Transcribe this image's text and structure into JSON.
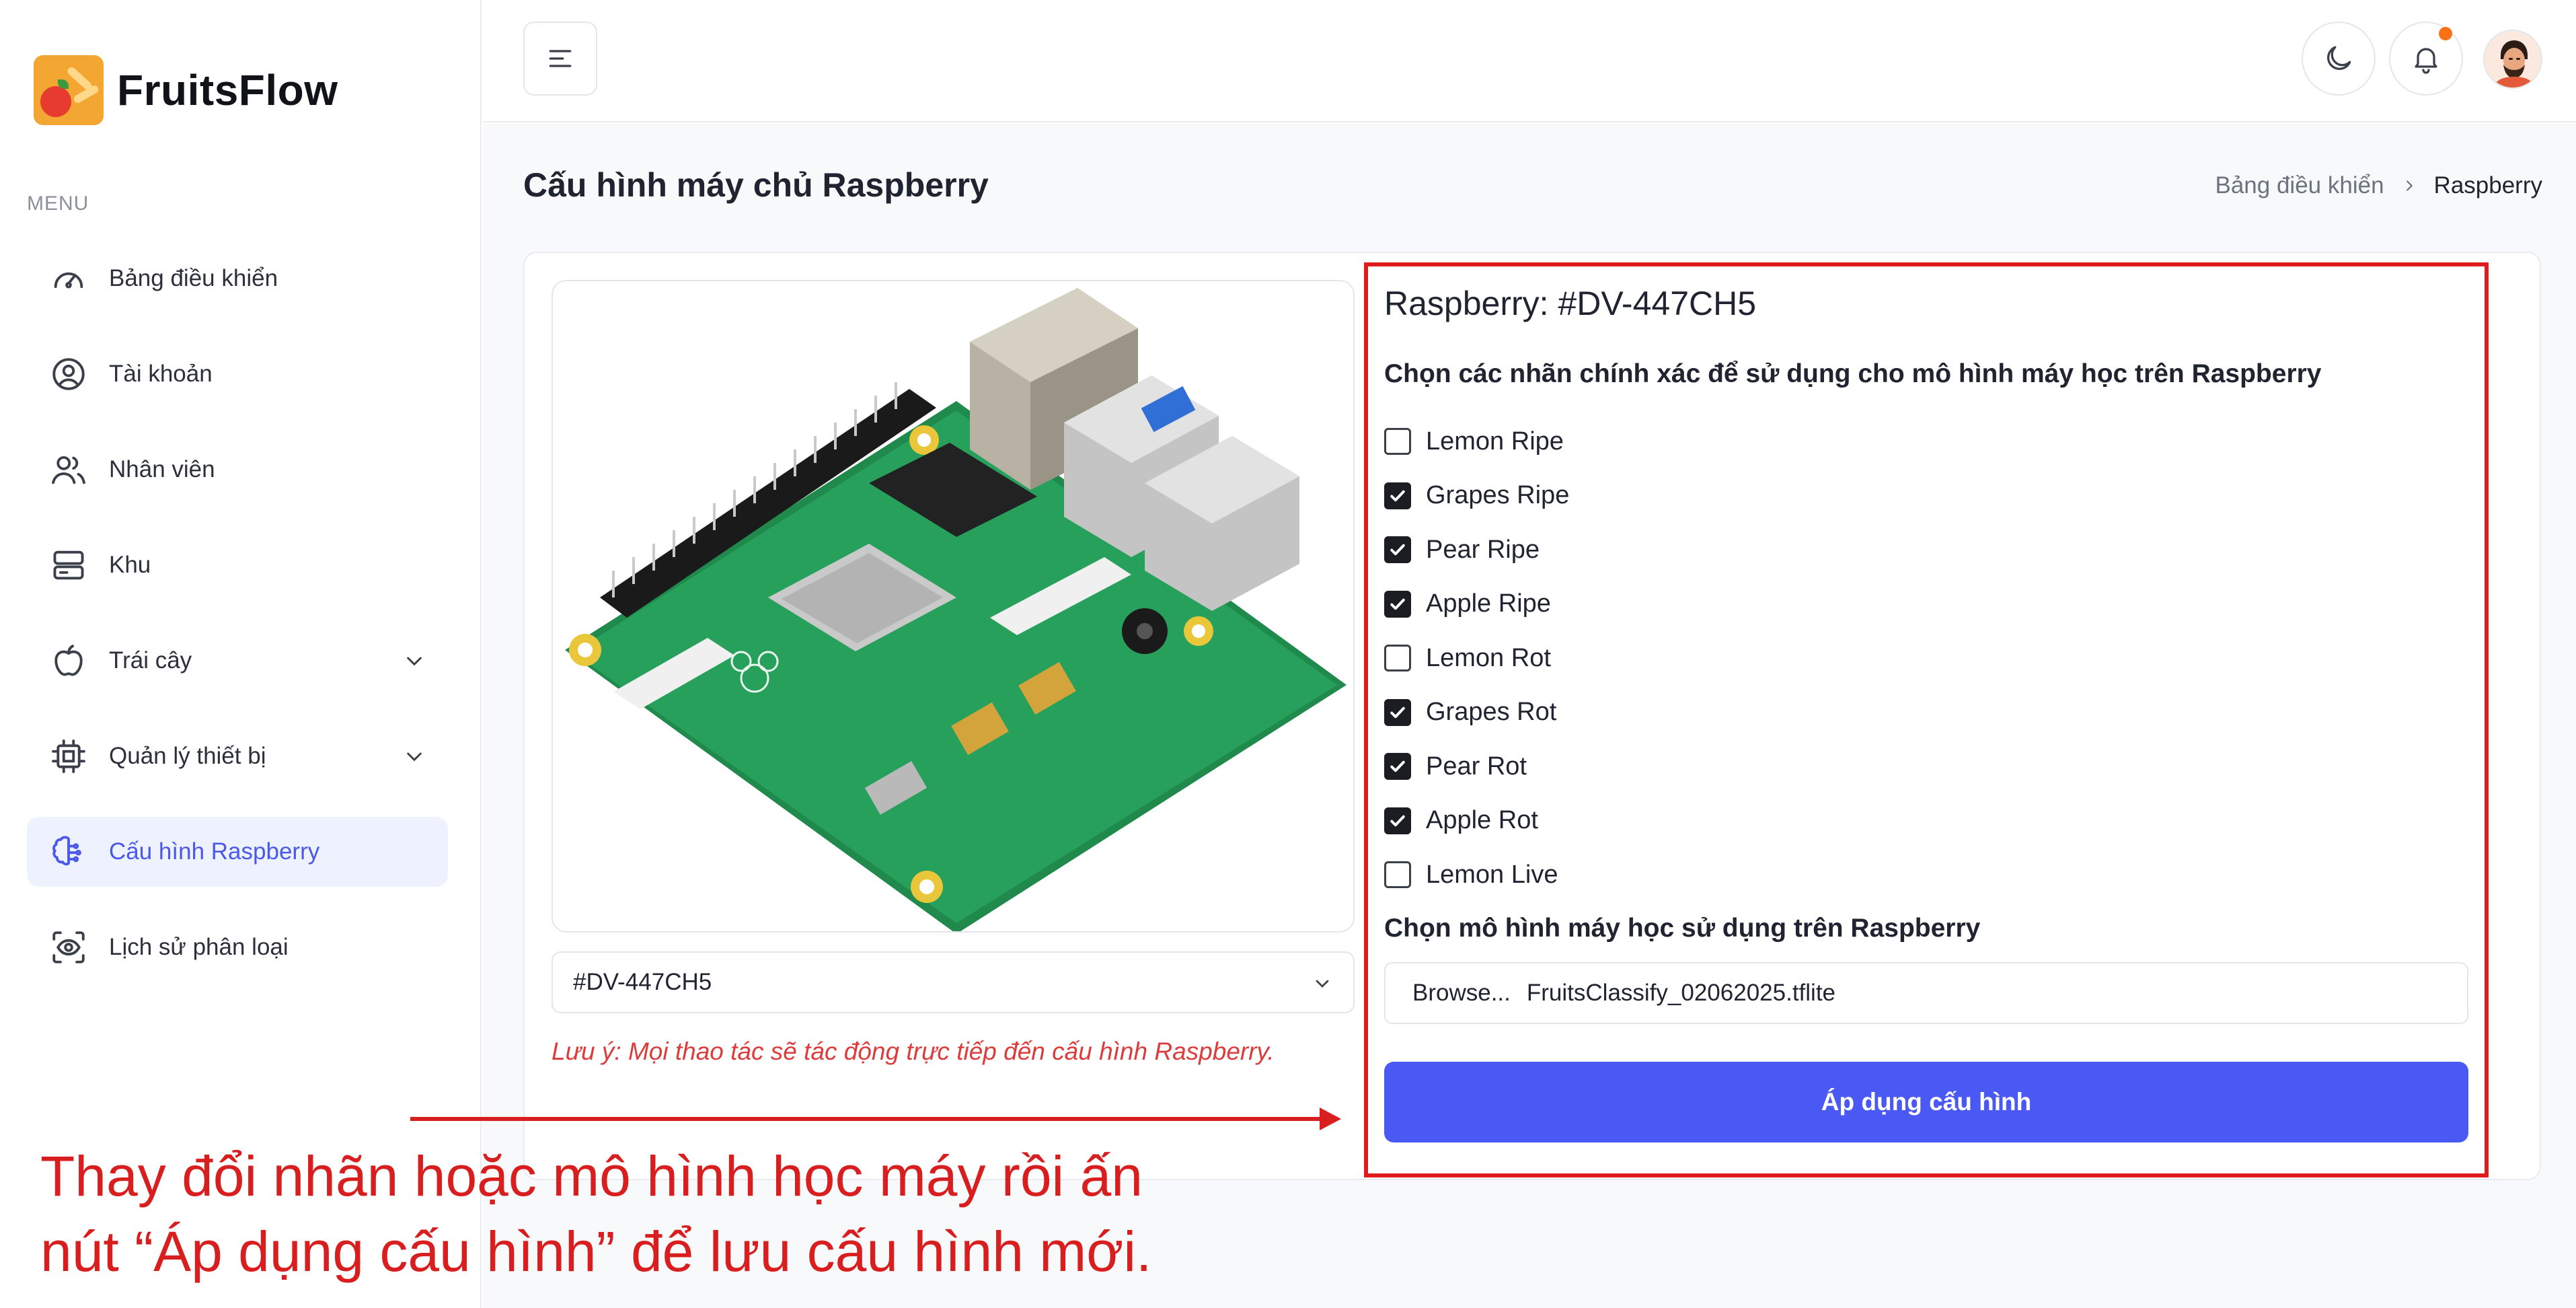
{
  "app": {
    "name": "FruitsFlow"
  },
  "sidebar": {
    "menu_label": "MENU",
    "items": [
      {
        "label": "Bảng điều khiển",
        "icon": "dashboard-gauge-icon"
      },
      {
        "label": "Tài khoản",
        "icon": "user-circle-icon"
      },
      {
        "label": "Nhân viên",
        "icon": "users-icon"
      },
      {
        "label": "Khu",
        "icon": "server-icon"
      },
      {
        "label": "Trái cây",
        "icon": "apple-icon",
        "expandable": true
      },
      {
        "label": "Quản lý thiết bị",
        "icon": "cpu-chip-icon",
        "expandable": true
      },
      {
        "label": "Cấu hình Raspberry",
        "icon": "brain-icon",
        "active": true
      },
      {
        "label": "Lịch sử phân loại",
        "icon": "eye-scan-icon"
      }
    ]
  },
  "header": {
    "menu_icon": "hamburger-icon",
    "theme_icon": "moon-icon",
    "notification_icon": "bell-icon",
    "notification_badge_color": "#f97316"
  },
  "page": {
    "title": "Cấu hình máy chủ Raspberry",
    "breadcrumb": {
      "parent": "Bảng điều khiển",
      "current": "Raspberry"
    }
  },
  "device": {
    "selected": "#DV-447CH5",
    "note": "Lưu ý: Mọi thao tác sẽ tác động trực tiếp đến cấu hình Raspberry."
  },
  "config": {
    "title": "Raspberry: #DV-447CH5",
    "labels_heading": "Chọn các nhãn chính xác để sử dụng cho mô hình máy học trên Raspberry",
    "labels": [
      {
        "label": "Lemon Ripe",
        "checked": false
      },
      {
        "label": "Grapes Ripe",
        "checked": true
      },
      {
        "label": "Pear Ripe",
        "checked": true
      },
      {
        "label": "Apple Ripe",
        "checked": true
      },
      {
        "label": "Lemon Rot",
        "checked": false
      },
      {
        "label": "Grapes Rot",
        "checked": true
      },
      {
        "label": "Pear Rot",
        "checked": true
      },
      {
        "label": "Apple Rot",
        "checked": true
      },
      {
        "label": "Lemon Live",
        "checked": false
      }
    ],
    "model_heading": "Chọn mô hình máy học sử dụng trên Raspberry",
    "file_browse": "Browse...",
    "file_name": "FruitsClassify_02062025.tflite",
    "apply_label": "Áp dụng cấu hình",
    "accent": "#4b59f4"
  },
  "annotation": {
    "line1": "Thay đổi nhãn hoặc mô hình học máy rồi ấn",
    "line2": "nút “Áp dụng cấu hình” để lưu cấu hình mới.",
    "color": "#d81e1e"
  }
}
